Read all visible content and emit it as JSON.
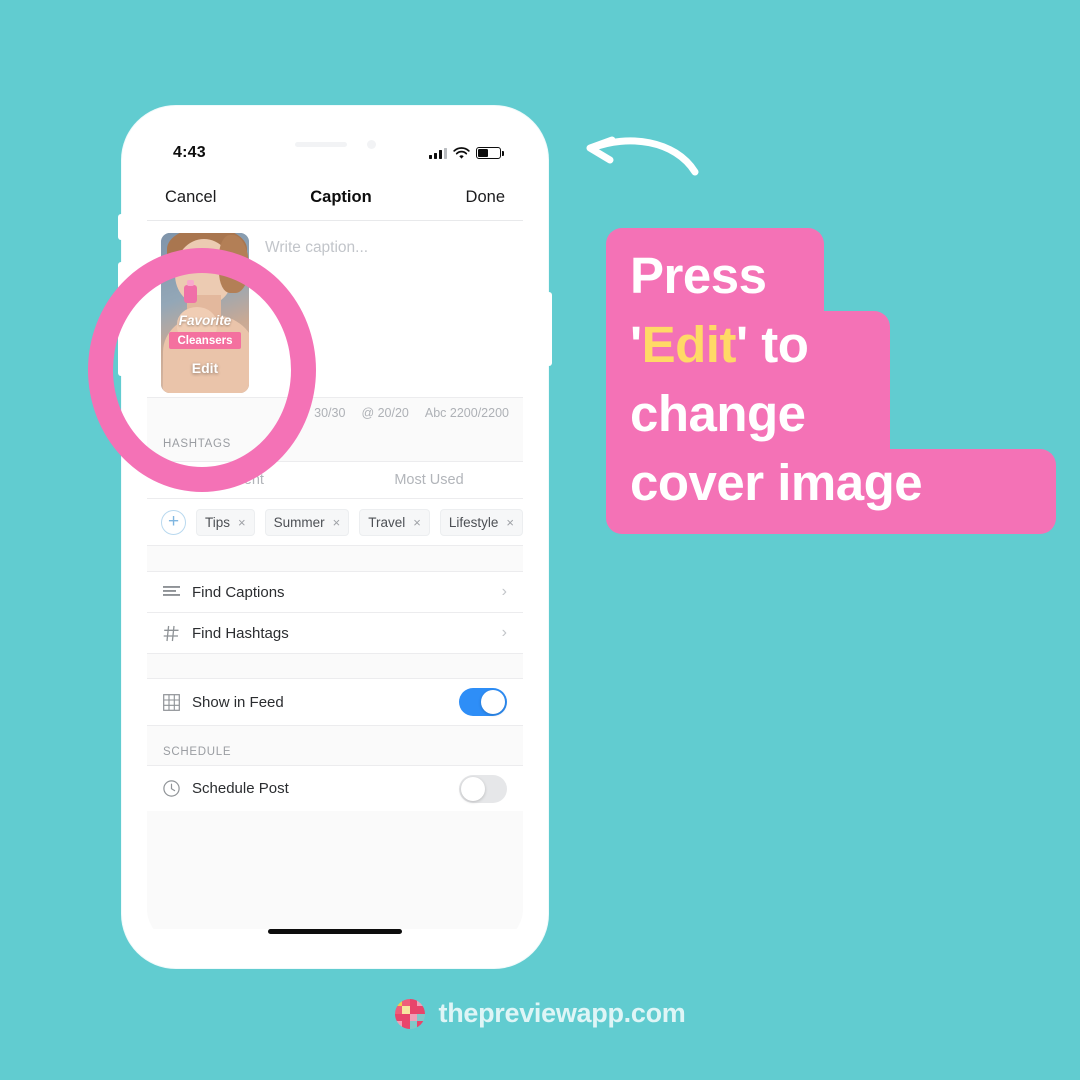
{
  "background": {
    "teal": "#61ccd0"
  },
  "phone": {
    "status_bar": {
      "time": "4:43",
      "signal_icon": "cellular-bars-icon",
      "wifi_icon": "wifi-icon",
      "battery_icon": "battery-icon"
    },
    "nav_bar": {
      "cancel_label": "Cancel",
      "title": "Caption",
      "done_label": "Done"
    },
    "caption": {
      "placeholder": "Write caption...",
      "cover_thumb": {
        "title_text": "Favorite",
        "badge_text": "Cleansers",
        "edit_label": "Edit"
      },
      "counters": [
        "30/30",
        "@ 20/20",
        "Abc 2200/2200"
      ]
    },
    "hashtags": {
      "section_label": "HASHTAGS",
      "tabs": [
        "Recent",
        "Most Used"
      ],
      "add_button": "+",
      "chips": [
        {
          "label": "Tips",
          "remove": "×"
        },
        {
          "label": "Summer",
          "remove": "×"
        },
        {
          "label": "Travel",
          "remove": "×"
        },
        {
          "label": "Lifestyle",
          "remove": "×"
        }
      ]
    },
    "menu": [
      {
        "icon": "lines-icon",
        "label": "Find Captions",
        "chevron": "›"
      },
      {
        "icon": "hash-icon",
        "label": "Find Hashtags",
        "chevron": "›"
      }
    ],
    "show_in_feed": {
      "icon": "grid-icon",
      "label": "Show in Feed",
      "state": "on",
      "accent": "#2e8ef7"
    },
    "schedule": {
      "section_label": "SCHEDULE",
      "icon": "clock-icon",
      "label": "Schedule Post",
      "state": "off"
    }
  },
  "annotation": {
    "ring_color": "#f472b6",
    "arrow_icon": "curved-arrow-left-icon",
    "callout": {
      "color": "#f472b6",
      "highlight_color": "#ffd966",
      "lines": [
        {
          "text": "Press"
        },
        {
          "pre": "'",
          "highlight": "Edit",
          "post": "' to"
        },
        {
          "text": "change"
        },
        {
          "text": "cover image"
        }
      ]
    }
  },
  "footer": {
    "logo_icon": "preview-app-logo-icon",
    "text": "thepreviewapp.com"
  }
}
